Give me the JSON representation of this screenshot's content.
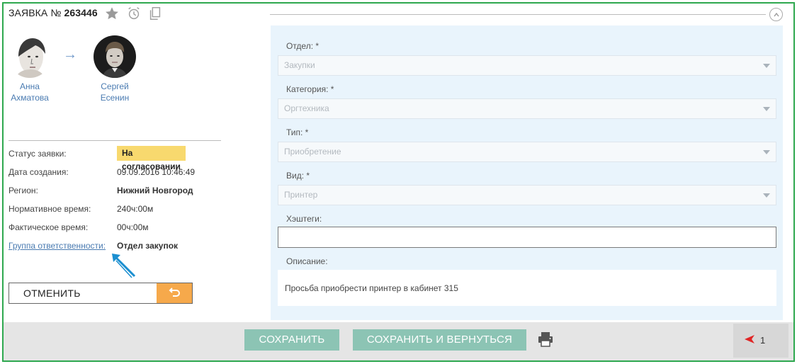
{
  "header": {
    "title_prefix": "ЗАЯВКА №",
    "ticket_number": "263446"
  },
  "flow": {
    "from": {
      "first": "Анна",
      "last": "Ахматова"
    },
    "to": {
      "first": "Сергей",
      "last": "Есенин"
    }
  },
  "info": {
    "status_label": "Статус заявки:",
    "status_value": "На согласовании",
    "created_label": "Дата создания:",
    "created_value": "09.09.2016 10:46:49",
    "region_label": "Регион:",
    "region_value": "Нижний Новгород",
    "norm_label": "Нормативное время:",
    "norm_value": "240ч:00м",
    "actual_label": "Фактическое время:",
    "actual_value": "00ч:00м",
    "group_label": "Группа ответственности:",
    "group_value": "Отдел закупок"
  },
  "actions": {
    "cancel": "ОТМЕНИТЬ",
    "save": "СОХРАНИТЬ",
    "save_return": "СОХРАНИТЬ И ВЕРНУТЬСЯ"
  },
  "form": {
    "dept_label": "Отдел: *",
    "dept_value": "Закупки",
    "category_label": "Категория: *",
    "category_value": "Оргтехника",
    "type_label": "Тип: *",
    "type_value": "Приобретение",
    "kind_label": "Вид: *",
    "kind_value": "Принтер",
    "hashtags_label": "Хэштеги:",
    "hashtags_value": "",
    "description_label": "Описание:",
    "description_value": "Просьба приобрести принтер в кабинет 315"
  },
  "counter": {
    "value": "1"
  },
  "colors": {
    "frame": "#2ea84f",
    "status_badge": "#f8d96e",
    "form_bg": "#e9f4fc",
    "green_button": "#8cc4b4",
    "undo_button": "#f6a94b",
    "link": "#4a7bb1"
  }
}
